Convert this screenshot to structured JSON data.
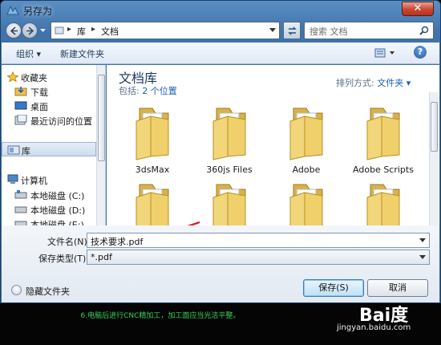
{
  "window": {
    "title": "另存为",
    "close_label": "✕"
  },
  "address": {
    "crumbs": [
      "库",
      "文档"
    ]
  },
  "search": {
    "placeholder": "搜索 文档"
  },
  "toolbar": {
    "organize": "组织 ▾",
    "new_folder": "新建文件夹"
  },
  "sidebar": {
    "items": [
      {
        "label": "收藏夹",
        "icon": "star-icon"
      },
      {
        "label": "下载",
        "icon": "download-folder-icon"
      },
      {
        "label": "桌面",
        "icon": "desktop-icon"
      },
      {
        "label": "最近访问的位置",
        "icon": "recent-places-icon"
      },
      {
        "label": "库",
        "icon": "library-icon"
      },
      {
        "label": "计算机",
        "icon": "computer-icon"
      },
      {
        "label": "本地磁盘 (C:)",
        "icon": "drive-icon"
      },
      {
        "label": "本地磁盘 (D:)",
        "icon": "drive-icon"
      },
      {
        "label": "本地磁盘 (E:)",
        "icon": "drive-icon"
      }
    ]
  },
  "library": {
    "title": "文档库",
    "includes_label": "包括: ",
    "includes_link": "2 个位置",
    "arrange_label": "排列方式: ",
    "arrange_value": "文件夹 ▾"
  },
  "folders": [
    "3dsMax",
    "360js Files",
    "Adobe",
    "Adobe Scripts",
    "",
    "",
    "",
    ""
  ],
  "form": {
    "filename_label": "文件名(N):",
    "filename_value": "技术要求.pdf",
    "filetype_label": "保存类型(T):",
    "filetype_value": "*.pdf"
  },
  "footer": {
    "hide_folders": "隐藏文件夹",
    "save": "保存(S)",
    "cancel": "取消"
  },
  "caption": "6.电脑后进行CNC精加工，加工面应当光洁平整。",
  "watermark": {
    "logo": "Bai度",
    "url": "jingyan.baidu.com"
  },
  "colors": {
    "accent": "#3f73aa",
    "annotation_arrow": "#e02020",
    "caption": "#39d35a"
  }
}
